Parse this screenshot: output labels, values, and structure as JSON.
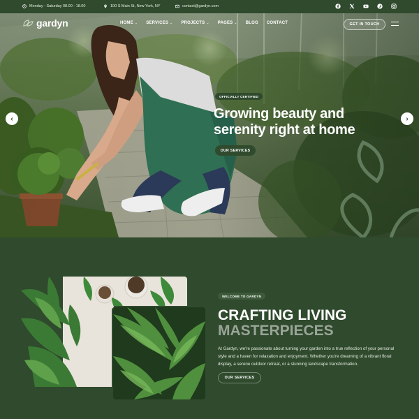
{
  "topbar": {
    "hours": "Monday - Saturday 08.00 - 18.00",
    "address": "100 S Main St, New York, NY",
    "email": "contact@gardyn.com",
    "socials": [
      "facebook-icon",
      "x-icon",
      "youtube-icon",
      "pinterest-icon",
      "instagram-icon"
    ]
  },
  "nav": {
    "logo": "gardyn",
    "items": [
      {
        "label": "HOME",
        "dropdown": true
      },
      {
        "label": "SERVICES",
        "dropdown": true
      },
      {
        "label": "PROJECTS",
        "dropdown": true
      },
      {
        "label": "PAGES",
        "dropdown": true
      },
      {
        "label": "BLOG",
        "dropdown": false
      },
      {
        "label": "CONTACT",
        "dropdown": false
      }
    ],
    "chevron": "⌄",
    "cta": "GET IN TOUCH"
  },
  "hero": {
    "badge": "OFFICIALLY CERTIFIED",
    "title": "Growing beauty and serenity right at home",
    "button": "OUR SERVICES",
    "prev": "‹",
    "next": "›"
  },
  "about": {
    "badge": "WELCOME TO GARDYN",
    "title_line1": "CRAFTING LIVING",
    "title_line2": "MASTERPIECES",
    "text": "At Gardyn, we're passionate about turning your garden into a true reflection of your personal style and a haven for relaxation and enjoyment. Whether you're dreaming of a vibrant floral display, a serene outdoor retreat, or a stunning landscape transformation.",
    "button": "OUR SERVICES"
  },
  "colors": {
    "primary": "#2f4a2d",
    "accent_text": "#9aa598",
    "white": "#ffffff"
  }
}
